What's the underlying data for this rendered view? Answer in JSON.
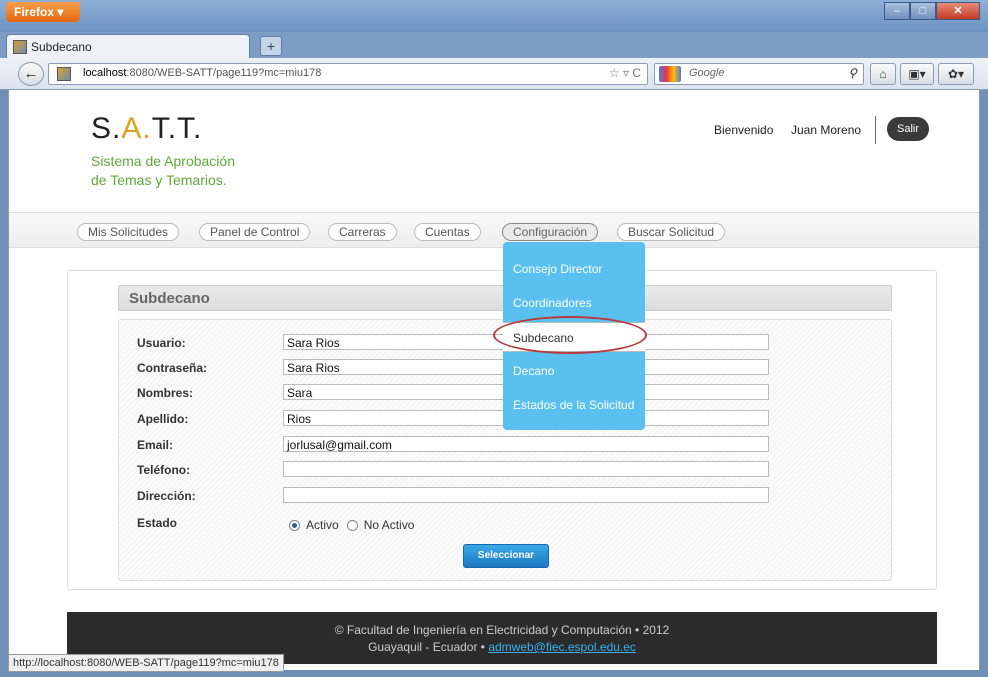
{
  "browser": {
    "menu_button": "Firefox",
    "tab_title": "Subdecano",
    "new_tab": "+",
    "url_host": "localhost",
    "url_path": ":8080/WEB-SATT/page119?mc=miu178",
    "search_placeholder": "Google",
    "status_url": "http://localhost:8080/WEB-SATT/page119?mc=miu178"
  },
  "header": {
    "logo_s": "S.",
    "logo_a": "A.",
    "logo_tt": "T.T.",
    "tagline_line1": "Sistema de Aprobación",
    "tagline_line2": "de Temas y Temarios.",
    "welcome": "Bienvenido",
    "user_name": "Juan Moreno",
    "logout": "Salir"
  },
  "menu": {
    "items": [
      "Mis Solicitudes",
      "Panel de Control",
      "Carreras",
      "Cuentas",
      "Configuración",
      "Buscar Solicitud"
    ],
    "active": "Configuración"
  },
  "dropdown": {
    "items": [
      "Consejo Director",
      "Coordinadores",
      "Subdecano",
      "Decano",
      "Estados de la Solicitud"
    ],
    "highlighted": "Subdecano"
  },
  "form": {
    "title": "Subdecano",
    "fields": [
      {
        "label": "Usuario:",
        "value": "Sara Rios"
      },
      {
        "label": "Contraseña:",
        "value": "Sara Rios"
      },
      {
        "label": "Nombres:",
        "value": "Sara"
      },
      {
        "label": "Apellido:",
        "value": "Rios"
      },
      {
        "label": "Email:",
        "value": "jorlusal@gmail.com"
      },
      {
        "label": "Teléfono:",
        "value": ""
      },
      {
        "label": "Dirección:",
        "value": ""
      }
    ],
    "estado_label": "Estado",
    "estado_options": [
      "Activo",
      "No Activo"
    ],
    "estado_selected": "Activo",
    "submit": "Seleccionar"
  },
  "footer": {
    "line1": "© Facultad de Ingeniería en Electricidad y Computación • 2012",
    "line2": "Guayaquil - Ecuador • ",
    "email": "admweb@fiec.espol.edu.ec"
  },
  "colors": {
    "accent": "#e0a020",
    "tagline": "#5fa83a",
    "dropdown": "#5ac0ef",
    "button": "#1a78c0"
  }
}
